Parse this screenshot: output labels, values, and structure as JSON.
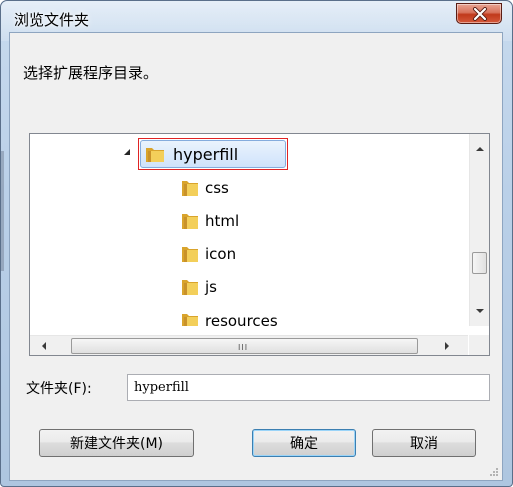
{
  "window": {
    "title": "浏览文件夹",
    "prompt": "选择扩展程序目录。"
  },
  "tree": {
    "selected": "hyperfill",
    "children": [
      "css",
      "html",
      "icon",
      "js",
      "resources"
    ]
  },
  "scroll": {
    "h_grip": "III"
  },
  "folder_field": {
    "label": "文件夹(F):",
    "value": "hyperfill"
  },
  "buttons": {
    "new_folder": "新建文件夹(M)",
    "ok": "确定",
    "cancel": "取消"
  },
  "colors": {
    "selection_outline": "#e02424",
    "folder": "#e8b93c",
    "close_button": "#c0391b"
  }
}
